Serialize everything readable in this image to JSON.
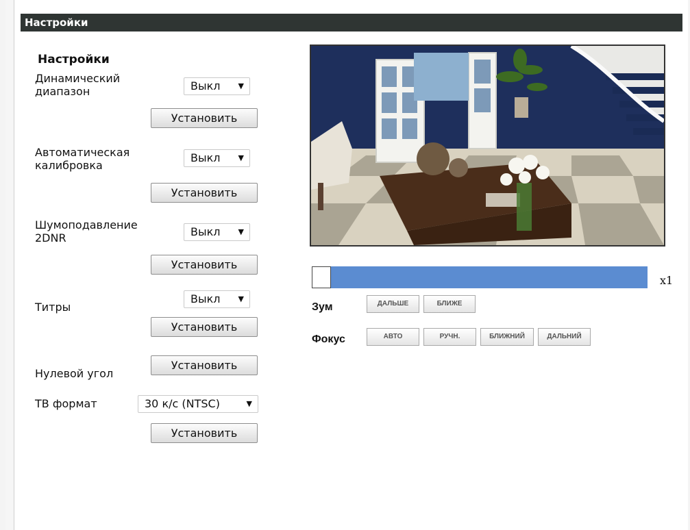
{
  "panel_title": "Настройки",
  "section_heading": "Настройки",
  "settings": {
    "dynamic_range": {
      "label_line1": "Динамический",
      "label_line2": "диапазон",
      "value": "Выкл",
      "button": "Установить"
    },
    "auto_calibration": {
      "label_line1": "Автоматическая",
      "label_line2": "калибровка",
      "value": "Выкл",
      "button": "Установить"
    },
    "noise_reduction": {
      "label_line1": "Шумоподавление",
      "label_line2": "2DNR",
      "value": "Выкл",
      "button": "Установить"
    },
    "captions": {
      "label": "Титры",
      "value": "Выкл",
      "button": "Установить"
    },
    "zero_angle": {
      "label": "Нулевой угол",
      "button": "Установить"
    },
    "tv_format": {
      "label": "ТВ формат",
      "value": "30 к/с (NTSC)",
      "button": "Установить"
    }
  },
  "dropdown_arrow": "▼",
  "preview": {
    "zoom_level": 0.0,
    "zoom_text": "x1"
  },
  "zoom": {
    "label": "Зум",
    "far": "ДАЛЬШЕ",
    "near": "БЛИЖЕ"
  },
  "focus": {
    "label": "Фокус",
    "auto": "АВТО",
    "manual": "РУЧН.",
    "near": "БЛИЖНИЙ",
    "far": "ДАЛЬНИЙ"
  },
  "colors": {
    "title_bar": "#2f3533",
    "slider": "#5b8cd1"
  }
}
